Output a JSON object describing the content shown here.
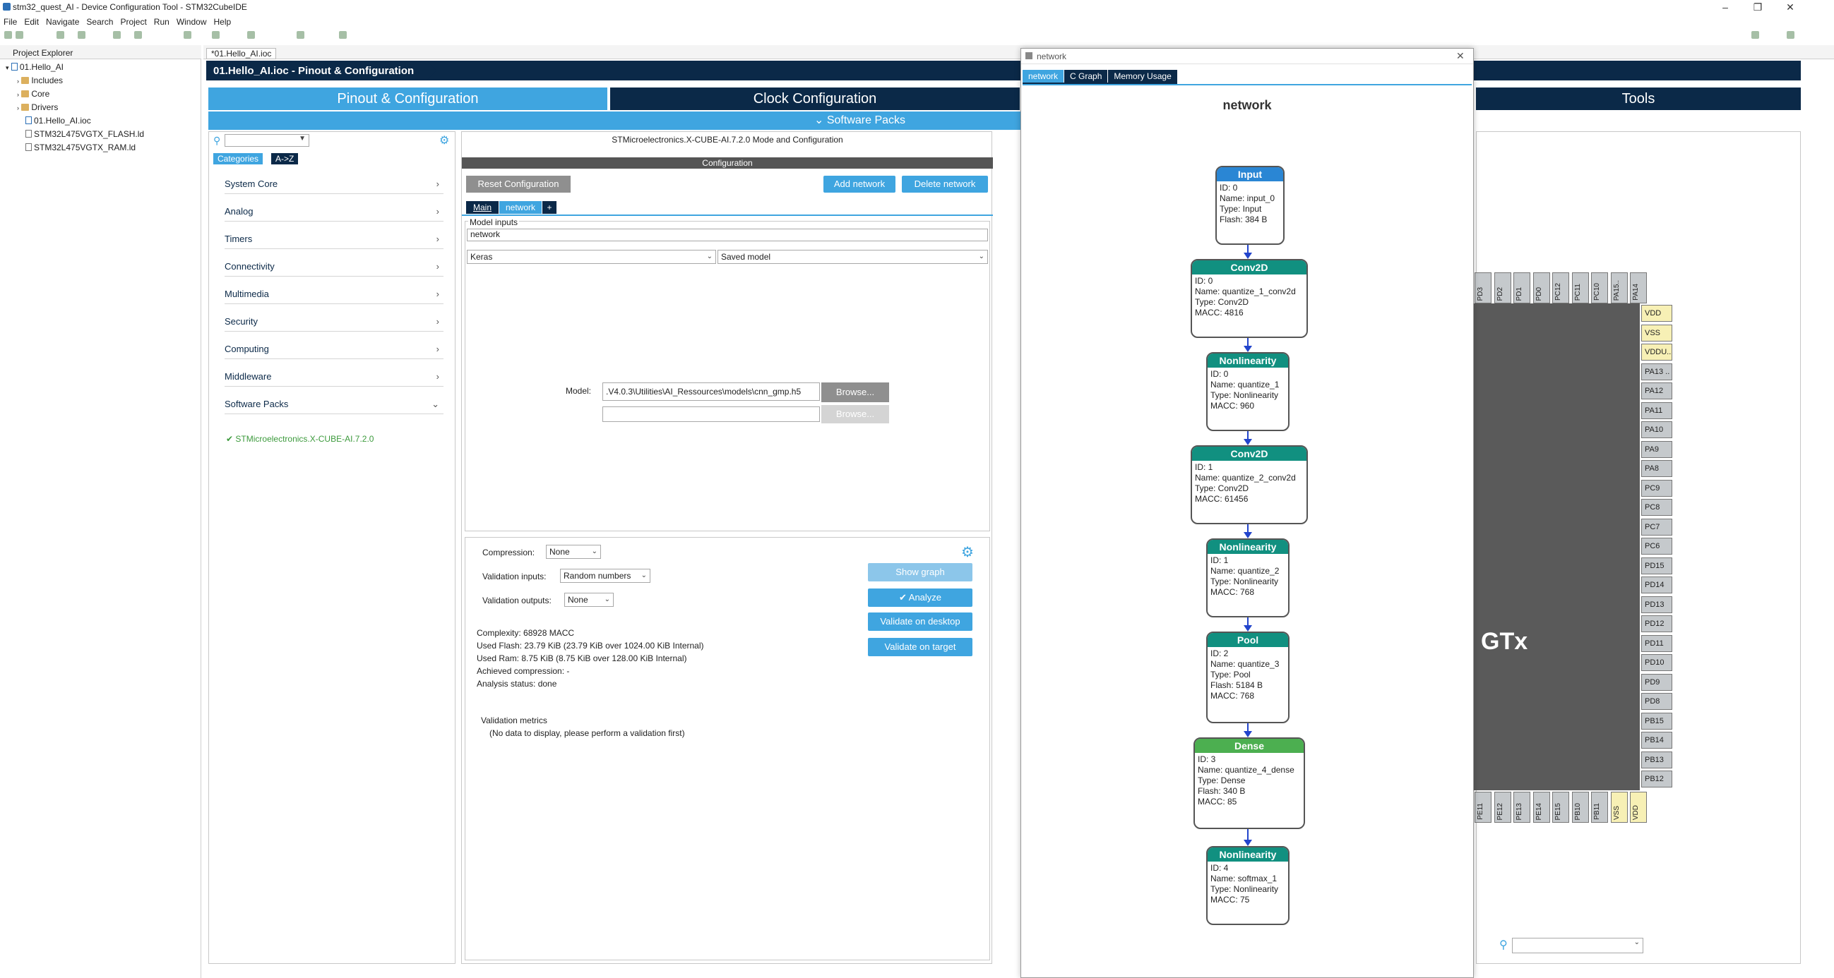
{
  "window": {
    "title": "stm32_quest_AI - Device Configuration Tool - STM32CubeIDE"
  },
  "menu": [
    "File",
    "Edit",
    "Navigate",
    "Search",
    "Project",
    "Run",
    "Window",
    "Help"
  ],
  "explorer": {
    "tab": "Project Explorer",
    "root": "01.Hello_AI",
    "items": [
      "Includes",
      "Core",
      "Drivers"
    ],
    "files": [
      "01.Hello_AI.ioc",
      "STM32L475VGTX_FLASH.ld",
      "STM32L475VGTX_RAM.ld"
    ]
  },
  "editor": {
    "tab": "*01.Hello_AI.ioc",
    "header": "01.Hello_AI.ioc - Pinout & Configuration"
  },
  "main_tabs": [
    "Pinout & Configuration",
    "Clock Configuration",
    "Tools"
  ],
  "sub_menu": "Software Packs",
  "categories": {
    "tabs": [
      "Categories",
      "A->Z"
    ],
    "items": [
      "System Core",
      "Analog",
      "Timers",
      "Connectivity",
      "Multimedia",
      "Security",
      "Computing",
      "Middleware",
      "Software Packs"
    ],
    "pack": "STMicroelectronics.X-CUBE-AI.7.2.0"
  },
  "config": {
    "title": "STMicroelectronics.X-CUBE-AI.7.2.0 Mode and Configuration",
    "section": "Configuration",
    "reset": "Reset Configuration",
    "add": "Add network",
    "delete": "Delete network",
    "tabs": [
      "Main",
      "network",
      "+"
    ],
    "model_inputs": "Model inputs",
    "name": "network",
    "framework": "Keras",
    "model_type": "Saved model",
    "model_label": "Model:",
    "model_path": ".V4.0.3\\Utilities\\AI_Ressources\\models\\cnn_gmp.h5",
    "browse": "Browse...",
    "compression_label": "Compression:",
    "compression": "None",
    "vinputs_label": "Validation inputs:",
    "vinputs": "Random numbers",
    "voutputs_label": "Validation outputs:",
    "voutputs": "None",
    "show_graph": "Show graph",
    "analyze": "Analyze",
    "validate_desktop": "Validate on desktop",
    "validate_target": "Validate on target",
    "complexity": "Complexity:  68928 MACC",
    "flash": "Used Flash: 23.79 KiB (23.79 KiB over 1024.00 KiB Internal)",
    "ram": "Used Ram: 8.75 KiB (8.75 KiB over 128.00 KiB Internal)",
    "compression_achieved": "Achieved compression: -",
    "status": "Analysis status: done",
    "metrics": "Validation metrics",
    "metrics_empty": "(No data to display, please perform a validation first)"
  },
  "dialog": {
    "title": "network",
    "tabs": [
      "network",
      "C Graph",
      "Memory Usage"
    ],
    "graph_title": "network",
    "nodes": [
      {
        "type": "Input",
        "lines": [
          "ID: 0",
          "Name: input_0",
          "Type: Input",
          "Flash: 384 B"
        ],
        "color": "#2a86d4"
      },
      {
        "type": "Conv2D",
        "lines": [
          "ID: 0",
          "Name: quantize_1_conv2d",
          "Type: Conv2D",
          "MACC: 4816"
        ],
        "color": "#119080"
      },
      {
        "type": "Nonlinearity",
        "lines": [
          "ID: 0",
          "Name: quantize_1",
          "Type: Nonlinearity",
          "MACC: 960"
        ],
        "color": "#119080"
      },
      {
        "type": "Conv2D",
        "lines": [
          "ID: 1",
          "Name: quantize_2_conv2d",
          "Type: Conv2D",
          "MACC: 61456"
        ],
        "color": "#119080"
      },
      {
        "type": "Nonlinearity",
        "lines": [
          "ID: 1",
          "Name: quantize_2",
          "Type: Nonlinearity",
          "MACC: 768"
        ],
        "color": "#119080"
      },
      {
        "type": "Pool",
        "lines": [
          "ID: 2",
          "Name: quantize_3",
          "Type: Pool",
          "Flash: 5184 B",
          "MACC: 768"
        ],
        "color": "#119080"
      },
      {
        "type": "Dense",
        "lines": [
          "ID: 3",
          "Name: quantize_4_dense",
          "Type: Dense",
          "Flash: 340 B",
          "MACC: 85"
        ],
        "color": "#4caf50"
      },
      {
        "type": "Nonlinearity",
        "lines": [
          "ID: 4",
          "Name: softmax_1",
          "Type: Nonlinearity",
          "MACC: 75"
        ],
        "color": "#119080"
      }
    ]
  },
  "chip": {
    "label": "GTx",
    "right_pins": [
      "VDD",
      "VSS",
      "VDDU..",
      "PA13 ..",
      "PA12",
      "PA11",
      "PA10",
      "PA9",
      "PA8",
      "PC9",
      "PC8",
      "PC7",
      "PC6",
      "PD15",
      "PD14",
      "PD13",
      "PD12",
      "PD11",
      "PD10",
      "PD9",
      "PD8",
      "PB15",
      "PB14",
      "PB13",
      "PB12"
    ],
    "top_pins": [
      "PD3",
      "PD2",
      "PD1",
      "PD0",
      "PC12",
      "PC11",
      "PC10",
      "PA15..",
      "PA14"
    ],
    "bottom_pins": [
      "PE11",
      "PE12",
      "PE13",
      "PE14",
      "PE15",
      "PB10",
      "PB11",
      "VSS",
      "VDD"
    ]
  }
}
